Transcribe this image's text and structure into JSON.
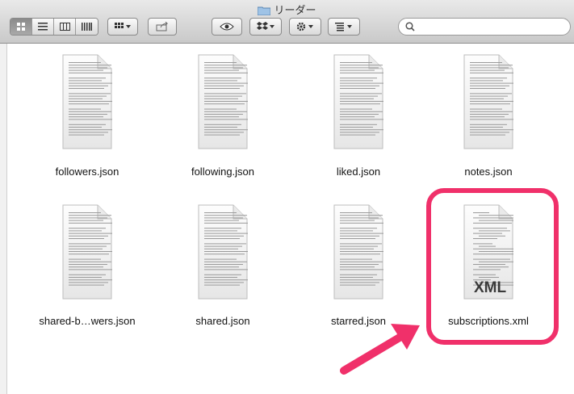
{
  "window": {
    "title": "リーダー"
  },
  "toolbar": {
    "view_modes": [
      "icon-view",
      "list-view",
      "column-view",
      "coverflow-view"
    ],
    "active_view": "icon-view",
    "search": {
      "placeholder": "",
      "value": ""
    }
  },
  "files": [
    {
      "name": "followers.json",
      "type": "json"
    },
    {
      "name": "following.json",
      "type": "json"
    },
    {
      "name": "liked.json",
      "type": "json"
    },
    {
      "name": "notes.json",
      "type": "json"
    },
    {
      "name": "shared-b…wers.json",
      "type": "json"
    },
    {
      "name": "shared.json",
      "type": "json"
    },
    {
      "name": "starred.json",
      "type": "json"
    },
    {
      "name": "subscriptions.xml",
      "type": "xml",
      "badge": "XML",
      "highlighted": true
    }
  ],
  "colors": {
    "highlight": "#f0306a",
    "arrow": "#f0306a"
  }
}
